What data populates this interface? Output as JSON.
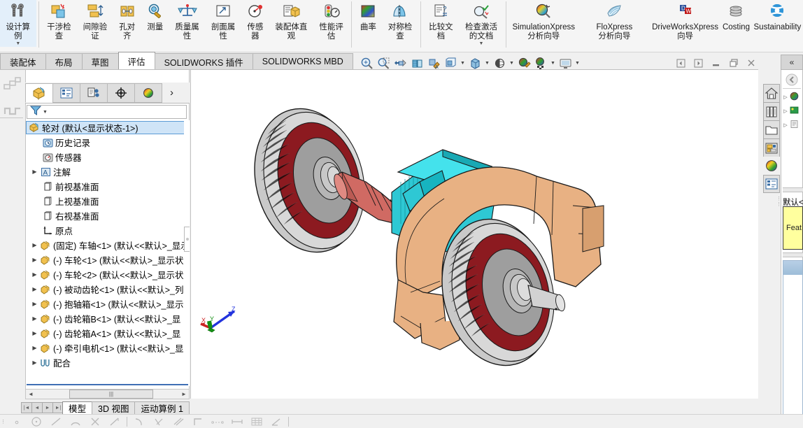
{
  "app": {
    "title": "SOLIDWORKS",
    "accent": "#2f7fbf"
  },
  "ribbon": {
    "groups": [
      {
        "name": "design-study",
        "items": [
          {
            "label": "设计算例",
            "icon": "design-study-icon",
            "has_caret": true
          }
        ]
      },
      {
        "name": "evaluate-tools",
        "items": [
          {
            "label": "干涉检查",
            "icon": "interference-detection-icon",
            "has_caret": false
          },
          {
            "label": "间隙验证",
            "icon": "clearance-verification-icon",
            "has_caret": false
          },
          {
            "label": "孔对齐",
            "icon": "hole-alignment-icon",
            "has_caret": false
          },
          {
            "label": "测量",
            "icon": "measure-icon",
            "has_caret": false
          },
          {
            "label": "质量属性",
            "icon": "mass-properties-icon",
            "has_caret": false
          },
          {
            "label": "剖面属性",
            "icon": "section-properties-icon",
            "has_caret": false
          },
          {
            "label": "传感器",
            "icon": "sensor-icon",
            "has_caret": false
          },
          {
            "label": "装配体直观",
            "icon": "assembly-visualization-icon",
            "has_caret": false
          },
          {
            "label": "性能评估",
            "icon": "performance-evaluation-icon",
            "has_caret": false
          }
        ]
      },
      {
        "name": "curvature-symmetry",
        "items": [
          {
            "label": "曲率",
            "icon": "curvature-icon",
            "has_caret": false
          },
          {
            "label": "对称检查",
            "icon": "symmetry-check-icon",
            "has_caret": false
          }
        ]
      },
      {
        "name": "compare-documents",
        "items": [
          {
            "label": "比较文档",
            "icon": "compare-documents-icon",
            "has_caret": false
          },
          {
            "label": "检查激活的文档",
            "icon": "check-active-document-icon",
            "has_caret": true
          }
        ]
      },
      {
        "name": "xpress-wizards",
        "items": [
          {
            "label": "SimulationXpress 分析向导",
            "icon": "simulationxpress-icon",
            "has_caret": false,
            "wide": true
          },
          {
            "label": "FloXpress 分析向导",
            "icon": "floxpress-icon",
            "has_caret": false,
            "wide": true
          },
          {
            "label": "DriveWorksXpress 向导",
            "icon": "driveworksxpress-icon",
            "has_caret": false,
            "wide": true
          },
          {
            "label": "Costing",
            "icon": "costing-icon",
            "has_caret": false,
            "wide": true
          },
          {
            "label": "Sustainability",
            "icon": "sustainability-icon",
            "has_caret": false,
            "wide": true
          }
        ]
      }
    ]
  },
  "command_tabs": {
    "items": [
      {
        "label": "装配体",
        "active": false
      },
      {
        "label": "布局",
        "active": false
      },
      {
        "label": "草图",
        "active": false
      },
      {
        "label": "评估",
        "active": true
      },
      {
        "label": "SOLIDWORKS 插件",
        "active": false
      },
      {
        "label": "SOLIDWORKS MBD",
        "active": false
      }
    ]
  },
  "left_dock": {
    "items": [
      {
        "name": "flyout-featuremanager-icon"
      },
      {
        "name": "display-pane-icon"
      }
    ]
  },
  "feature_manager": {
    "tabs": [
      {
        "name": "featuremanager-design-tree-tab",
        "icon": "yellow-box-icon",
        "active": true
      },
      {
        "name": "property-manager-tab",
        "icon": "property-list-icon",
        "active": false
      },
      {
        "name": "configuration-manager-tab",
        "icon": "configuration-icon",
        "active": false
      },
      {
        "name": "dimxpert-manager-tab",
        "icon": "crosshair-icon",
        "active": false
      },
      {
        "name": "display-manager-tab",
        "icon": "appearance-sphere-icon",
        "active": false
      }
    ],
    "more_label": "›",
    "filter": {
      "placeholder": "",
      "value": "",
      "icon": "filter-funnel-icon"
    },
    "tree": [
      {
        "label": "轮对  (默认<显示状态-1>)",
        "icon": "assembly-icon",
        "indent": 0,
        "arrow": false,
        "selected": true
      },
      {
        "label": "历史记录",
        "icon": "history-icon",
        "indent": 1,
        "arrow": false,
        "selected": false
      },
      {
        "label": "传感器",
        "icon": "sensors-icon",
        "indent": 1,
        "arrow": false,
        "selected": false
      },
      {
        "label": "注解",
        "icon": "annotations-icon",
        "indent": 1,
        "arrow": true,
        "selected": false
      },
      {
        "label": "前视基准面",
        "icon": "plane-icon",
        "indent": 1,
        "arrow": false,
        "selected": false
      },
      {
        "label": "上视基准面",
        "icon": "plane-icon",
        "indent": 1,
        "arrow": false,
        "selected": false
      },
      {
        "label": "右视基准面",
        "icon": "plane-icon",
        "indent": 1,
        "arrow": false,
        "selected": false
      },
      {
        "label": "原点",
        "icon": "origin-icon",
        "indent": 1,
        "arrow": false,
        "selected": false
      },
      {
        "label": "(固定) 车轴<1>  (默认<<默认>_显示",
        "icon": "component-icon",
        "indent": 0,
        "arrow": true,
        "selected": false
      },
      {
        "label": "(-) 车轮<1>  (默认<<默认>_显示状",
        "icon": "component-icon",
        "indent": 0,
        "arrow": true,
        "selected": false
      },
      {
        "label": "(-) 车轮<2>  (默认<<默认>_显示状",
        "icon": "component-icon",
        "indent": 0,
        "arrow": true,
        "selected": false
      },
      {
        "label": "(-) 被动齿轮<1>  (默认<<默认>_列",
        "icon": "component-icon",
        "indent": 0,
        "arrow": true,
        "selected": false
      },
      {
        "label": "(-) 抱轴箱<1>  (默认<<默认>_显示",
        "icon": "component-icon",
        "indent": 0,
        "arrow": true,
        "selected": false
      },
      {
        "label": "(-) 齿轮箱B<1>  (默认<<默认>_显",
        "icon": "component-icon",
        "indent": 0,
        "arrow": true,
        "selected": false
      },
      {
        "label": "(-) 齿轮箱A<1>  (默认<<默认>_显",
        "icon": "component-icon",
        "indent": 0,
        "arrow": true,
        "selected": false
      },
      {
        "label": "(-) 牵引电机<1>  (默认<<默认>_显",
        "icon": "component-icon",
        "indent": 0,
        "arrow": true,
        "selected": false
      },
      {
        "label": "配合",
        "icon": "mates-icon",
        "indent": 0,
        "arrow": true,
        "selected": false
      }
    ],
    "hscroll": {
      "left_arrow": "◄",
      "right_arrow": "►",
      "thumb_glyph": "|||"
    }
  },
  "model_tabs": {
    "nav": [
      "|◄",
      "◄",
      "►",
      "►|"
    ],
    "items": [
      {
        "label": "模型",
        "active": true
      },
      {
        "label": "3D 视图",
        "active": false
      },
      {
        "label": "运动算例 1",
        "active": false
      }
    ]
  },
  "view_toolbar": {
    "items": [
      {
        "name": "zoom-to-fit-icon",
        "caret": false
      },
      {
        "name": "zoom-to-area-icon",
        "caret": false
      },
      {
        "name": "previous-view-icon",
        "caret": false
      },
      {
        "name": "section-view-icon",
        "caret": false
      },
      {
        "name": "view-orientation-paint-icon",
        "caret": false
      },
      {
        "name": "view-orientation-icon",
        "caret": true
      },
      {
        "name": "display-style-icon",
        "caret": true
      },
      {
        "name": "hide-show-items-icon",
        "caret": true
      },
      {
        "name": "edit-appearance-icon",
        "caret": false
      },
      {
        "name": "apply-scene-icon",
        "caret": true
      },
      {
        "name": "view-settings-icon",
        "caret": true
      }
    ]
  },
  "window_controls": [
    {
      "name": "previous-document-button",
      "glyph": "◁"
    },
    {
      "name": "next-document-button",
      "glyph": "▷"
    },
    {
      "name": "minimize-button",
      "glyph": "—"
    },
    {
      "name": "restore-button",
      "glyph": "❐"
    },
    {
      "name": "close-button",
      "glyph": "✕"
    }
  ],
  "task_pane": {
    "collapse_glyph": "«",
    "buttons": [
      {
        "name": "solidworks-resources-home-icon"
      },
      {
        "name": "design-library-icon"
      },
      {
        "name": "file-explorer-icon"
      },
      {
        "name": "view-palette-icon"
      },
      {
        "name": "appearances-scenes-decals-icon"
      },
      {
        "name": "custom-properties-icon"
      }
    ],
    "config_label": "默认<",
    "config_note": "Feat",
    "tree_rows": [
      {
        "name": "appearances-row",
        "arrow": "▷"
      },
      {
        "name": "scenes-row",
        "arrow": "▷"
      },
      {
        "name": "decals-row",
        "arrow": "▷"
      }
    ]
  },
  "viewport": {
    "model_name": "轮对",
    "triad": {
      "x_label": "X",
      "y_label": "Y",
      "z_label": "Z"
    },
    "colors": {
      "wheel_rim_dark_red": "#8c1a20",
      "wheel_hub_gray": "#9b9b9b",
      "axle_red": "#d06a63",
      "motor_cyan": "#35d8e3",
      "gearbox_tan": "#e0a977",
      "outline": "#1a1a1a"
    }
  },
  "sketch_bar": {
    "icons": [
      "point-icon",
      "circle-icon",
      "line-icon",
      "arc-icon",
      "trim-icon",
      "dimension-line-icon",
      "divider",
      "tangent-arc-icon",
      "sketch-fillet-icon",
      "offset-icon",
      "corner-rectangle-icon",
      "construction-geometry-icon",
      "smart-dimension-icon",
      "linear-pattern-icon",
      "angle-icon"
    ]
  }
}
